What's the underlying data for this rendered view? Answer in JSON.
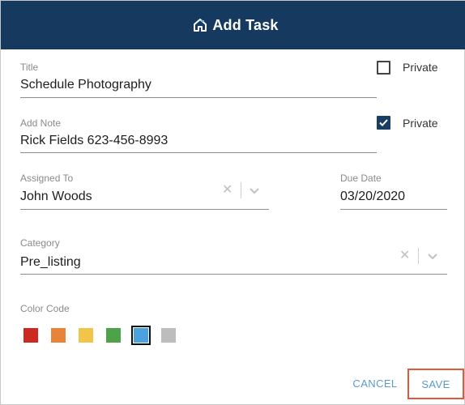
{
  "dialog": {
    "title": "Add Task",
    "icon": "home-icon"
  },
  "title_field": {
    "label": "Title",
    "value": "Schedule Photography",
    "private_label": "Private",
    "private_checked": false
  },
  "note_field": {
    "label": "Add Note",
    "value": "Rick Fields 623-456-8993",
    "private_label": "Private",
    "private_checked": true
  },
  "assigned_to": {
    "label": "Assigned To",
    "value": "John Woods",
    "clear_icon": "clear-x-icon",
    "dropdown_icon": "chevron-down-icon"
  },
  "due_date": {
    "label": "Due Date",
    "value": "03/20/2020"
  },
  "category": {
    "label": "Category",
    "value": "Pre_listing",
    "clear_icon": "clear-x-icon",
    "dropdown_icon": "chevron-down-icon"
  },
  "color_code": {
    "label": "Color Code",
    "swatches": [
      {
        "name": "red",
        "color": "#cc2a20"
      },
      {
        "name": "orange",
        "color": "#e8843a"
      },
      {
        "name": "yellow",
        "color": "#f2c54a"
      },
      {
        "name": "green",
        "color": "#4ea249"
      },
      {
        "name": "blue",
        "color": "#4aa3de"
      },
      {
        "name": "gray",
        "color": "#bdbdbd"
      }
    ],
    "selected": "blue"
  },
  "actions": {
    "cancel_label": "CANCEL",
    "save_label": "SAVE"
  },
  "colors": {
    "header_bg": "#163a5f",
    "accent": "#5b9ac7",
    "save_highlight": "#e05a3a"
  }
}
